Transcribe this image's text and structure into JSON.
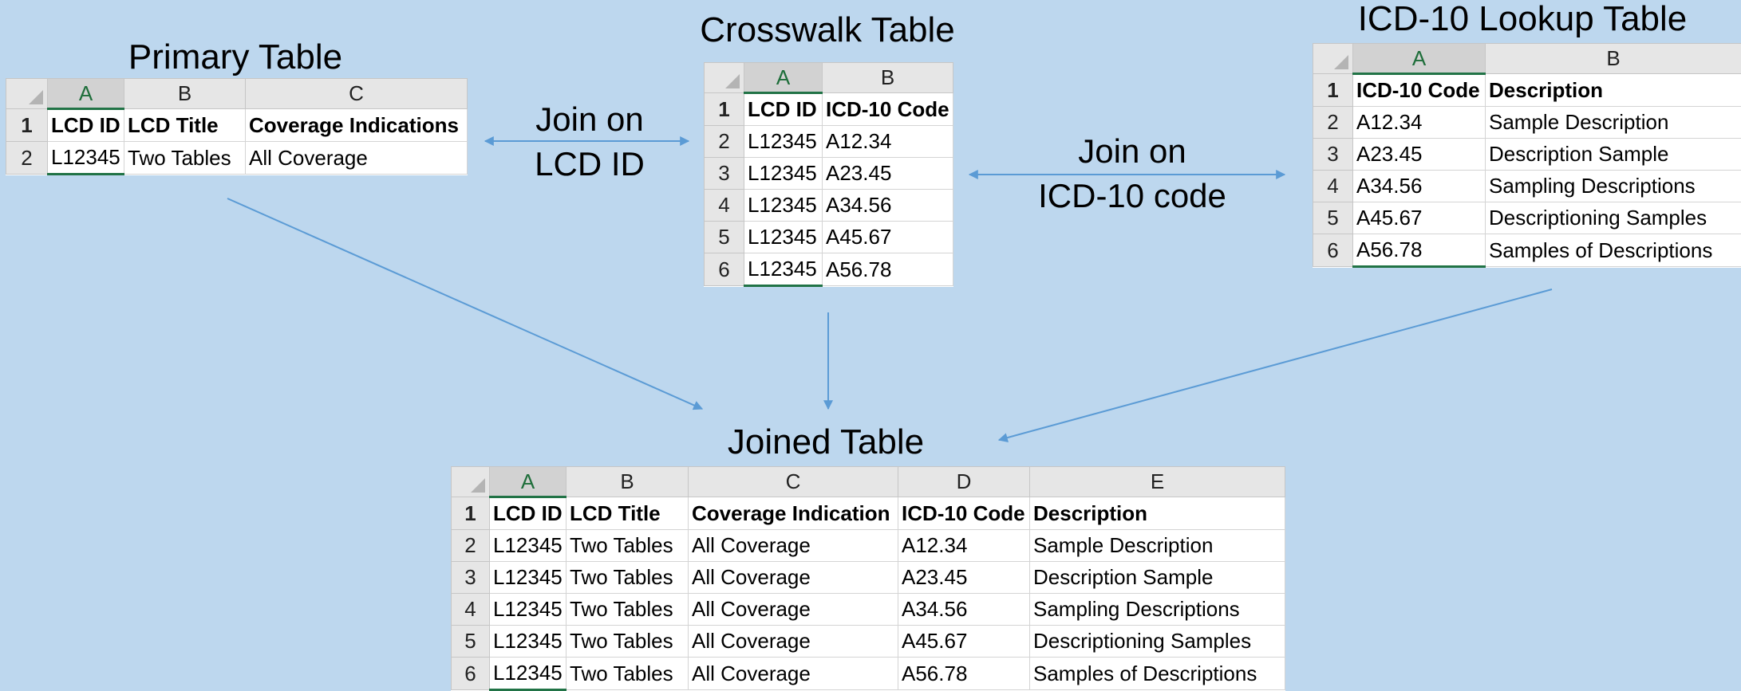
{
  "primary": {
    "title": "Primary Table",
    "col_letters": [
      "A",
      "B",
      "C"
    ],
    "row_numbers": [
      "1",
      "2"
    ],
    "headers": [
      "LCD ID",
      "LCD Title",
      "Coverage Indications"
    ],
    "rows": [
      [
        "L12345",
        "Two Tables",
        "All Coverage"
      ]
    ]
  },
  "crosswalk": {
    "title": "Crosswalk Table",
    "col_letters": [
      "A",
      "B"
    ],
    "row_numbers": [
      "1",
      "2",
      "3",
      "4",
      "5",
      "6"
    ],
    "headers": [
      "LCD ID",
      "ICD-10 Code"
    ],
    "rows": [
      [
        "L12345",
        "A12.34"
      ],
      [
        "L12345",
        "A23.45"
      ],
      [
        "L12345",
        "A34.56"
      ],
      [
        "L12345",
        "A45.67"
      ],
      [
        "L12345",
        "A56.78"
      ]
    ]
  },
  "lookup": {
    "title": "ICD-10 Lookup Table",
    "col_letters": [
      "A",
      "B"
    ],
    "row_numbers": [
      "1",
      "2",
      "3",
      "4",
      "5",
      "6"
    ],
    "headers": [
      "ICD-10 Code",
      "Description"
    ],
    "rows": [
      [
        "A12.34",
        "Sample Description"
      ],
      [
        "A23.45",
        "Description Sample"
      ],
      [
        "A34.56",
        "Sampling Descriptions"
      ],
      [
        "A45.67",
        "Descriptioning Samples"
      ],
      [
        "A56.78",
        "Samples of Descriptions"
      ]
    ]
  },
  "joined": {
    "title": "Joined Table",
    "col_letters": [
      "A",
      "B",
      "C",
      "D",
      "E"
    ],
    "row_numbers": [
      "1",
      "2",
      "3",
      "4",
      "5",
      "6"
    ],
    "headers": [
      "LCD ID",
      "LCD Title",
      "Coverage Indication",
      "ICD-10 Code",
      "Description"
    ],
    "rows": [
      [
        "L12345",
        "Two Tables",
        "All Coverage",
        "A12.34",
        "Sample Description"
      ],
      [
        "L12345",
        "Two Tables",
        "All Coverage",
        "A23.45",
        "Description Sample"
      ],
      [
        "L12345",
        "Two Tables",
        "All Coverage",
        "A34.56",
        "Sampling Descriptions"
      ],
      [
        "L12345",
        "Two Tables",
        "All Coverage",
        "A45.67",
        "Descriptioning Samples"
      ],
      [
        "L12345",
        "Two Tables",
        "All Coverage",
        "A56.78",
        "Samples of Descriptions"
      ]
    ]
  },
  "join1": {
    "line1": "Join on",
    "line2": "LCD ID"
  },
  "join2": {
    "line1": "Join on",
    "line2": "ICD-10 code"
  },
  "colors": {
    "background": "#bdd7ee",
    "arrow": "#5b9bd5",
    "selected_column": "#217346"
  }
}
